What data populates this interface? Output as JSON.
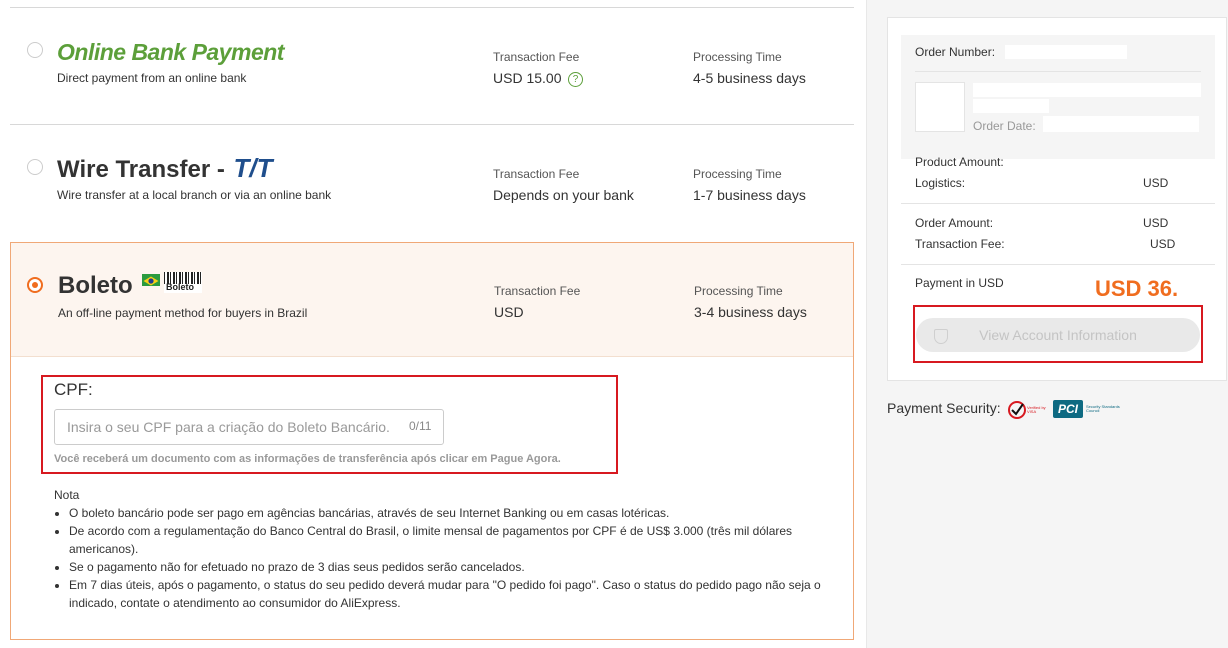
{
  "payment_methods": [
    {
      "title": "Online Bank Payment",
      "subtitle": "Direct payment from an online bank",
      "fee_label": "Transaction Fee",
      "fee_value": "USD 15.00",
      "time_label": "Processing Time",
      "time_value": "4-5 business days",
      "selected": false
    },
    {
      "title": "Wire Transfer -",
      "title_logo": "T/T",
      "subtitle": "Wire transfer at a local branch or via an online bank",
      "fee_label": "Transaction Fee",
      "fee_value": "Depends on your bank",
      "time_label": "Processing Time",
      "time_value": "1-7 business days",
      "selected": false
    },
    {
      "title": "Boleto",
      "logo_text": "Boleto",
      "subtitle": "An off-line payment method for buyers in Brazil",
      "fee_label": "Transaction Fee",
      "fee_value": "USD",
      "time_label": "Processing Time",
      "time_value": "3-4 business days",
      "selected": true
    }
  ],
  "cpf": {
    "label": "CPF:",
    "placeholder": "Insira o seu CPF para a criação do Boleto Bancário.",
    "counter": "0/11",
    "hint": "Você receberá um documento com as informações de transferência após clicar em Pague Agora."
  },
  "note": {
    "title": "Nota",
    "items": [
      "O boleto bancário pode ser pago em agências bancárias, através de seu Internet Banking ou em casas lotéricas.",
      "De acordo com a regulamentação do Banco Central do Brasil, o limite mensal de pagamentos por CPF é de US$ 3.000 (três mil dólares americanos).",
      "Se o pagamento não for efetuado no prazo de 3 dias seus pedidos serão cancelados.",
      "Em 7 dias úteis, após o pagamento, o status do seu pedido deverá mudar para \"O pedido foi pago\". Caso o status do pedido pago não seja o indicado, contate o atendimento ao consumidor do AliExpress."
    ]
  },
  "summary": {
    "order_number_label": "Order Number:",
    "order_date_label": "Order Date:",
    "product_amount_label": "Product Amount:",
    "logistics_label": "Logistics:",
    "logistics_value": "USD",
    "order_amount_label": "Order Amount:",
    "order_amount_value": "USD",
    "transaction_fee_label": "Transaction Fee:",
    "transaction_fee_value": "USD",
    "payment_label": "Payment in USD",
    "payment_value": "USD 36.",
    "view_button": "View Account Information"
  },
  "security": {
    "label": "Payment Security:",
    "badge1": "Verified by VISA",
    "badge2": "PCI",
    "badge2_sub": "Security Standards Council"
  },
  "colors": {
    "accent": "#f06d1f",
    "online_bank_green": "#5c9f3a",
    "tt_blue": "#1f4e8c",
    "highlight_red": "#d71920"
  }
}
